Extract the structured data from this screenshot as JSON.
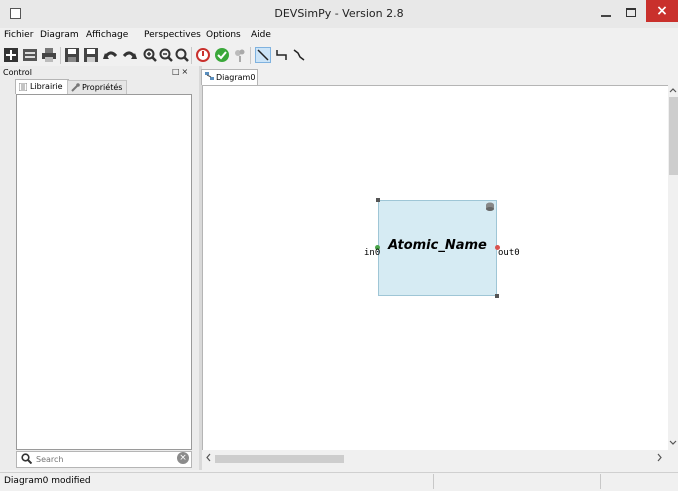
{
  "window": {
    "title": "DEVSimPy - Version 2.8",
    "controls": {
      "minimize": "–",
      "maximize": "□",
      "close": "×"
    }
  },
  "menu": [
    "Fichier",
    "Diagram",
    "Affichage",
    "Perspectives",
    "Options",
    "Aide"
  ],
  "toolbar": {
    "icons": [
      "new-icon",
      "open-icon",
      "print-icon",
      "save-icon",
      "save-as-icon",
      "undo-icon",
      "redo-icon",
      "zoom-in-icon",
      "zoom-out-icon",
      "zoom-reset-icon",
      "stop-icon",
      "check-icon",
      "plugin-icon",
      "direct-connector-icon",
      "square-connector-icon",
      "linear-connector-icon"
    ]
  },
  "control_panel": {
    "title": "Control",
    "buttons": "□×",
    "tabs": [
      {
        "label": "Librairie",
        "active": true
      },
      {
        "label": "Propriétés",
        "active": false
      }
    ],
    "search_placeholder": "Search"
  },
  "diagram": {
    "tab_label": "Diagram0",
    "block": {
      "name": "Atomic_Name",
      "in_port": "in0",
      "out_port": "out0",
      "fill_color": "#d6ebf3"
    }
  },
  "status": {
    "text": "Diagram0 modified"
  },
  "colors": {
    "close_button": "#c9302c",
    "selection_tool": "#cce4f7"
  }
}
